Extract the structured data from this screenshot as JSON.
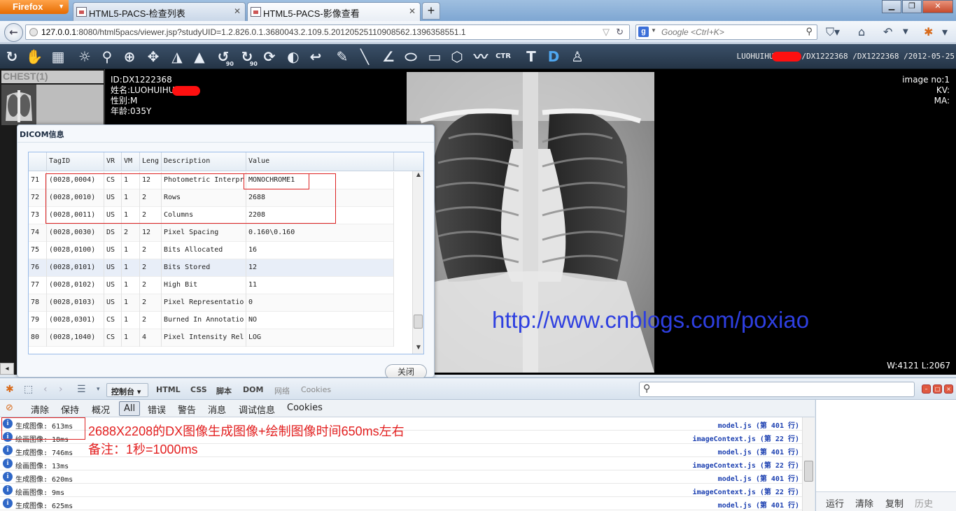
{
  "browser": {
    "app_button": "Firefox",
    "tabs": [
      {
        "label": "HTML5-PACS-检查列表"
      },
      {
        "label": "HTML5-PACS-影像查看"
      }
    ],
    "url_host": "127.0.0.1",
    "url_rest": ":8080/html5pacs/viewer.jsp?studyUID=1.2.826.0.1.3680043.2.109.5.20120525110908562.1396358551.1",
    "search_placeholder": "Google <Ctrl+K>"
  },
  "viewer": {
    "study_info_prefix": "LUOHUIHU",
    "study_info_suffix": "/DX1222368 /DX1222368 /2012-05-25",
    "series_title": "CHEST(1)",
    "patient": {
      "id_line": "ID:DX1222368",
      "name_line": "姓名:LUOHUIHU",
      "sex_line": "性别:M",
      "age_line": "年龄:035Y"
    },
    "image": {
      "image_no": "image no:1",
      "kv": "KV:",
      "ma": "MA:",
      "window_level": "W:4121 L:2067"
    },
    "watermark": "http://www.cnblogs.com/poxiao"
  },
  "dicom_dialog": {
    "title": "DICOM信息",
    "columns": [
      "TagID",
      "VR",
      "VM",
      "Leng",
      "Description",
      "Value"
    ],
    "rows": [
      {
        "n": "71",
        "tag": "(0028,0004)",
        "vr": "CS",
        "vm": "1",
        "len": "12",
        "desc": "Photometric Interpr",
        "value": "MONOCHROME1"
      },
      {
        "n": "72",
        "tag": "(0028,0010)",
        "vr": "US",
        "vm": "1",
        "len": "2",
        "desc": "Rows",
        "value": "2688"
      },
      {
        "n": "73",
        "tag": "(0028,0011)",
        "vr": "US",
        "vm": "1",
        "len": "2",
        "desc": "Columns",
        "value": "2208"
      },
      {
        "n": "74",
        "tag": "(0028,0030)",
        "vr": "DS",
        "vm": "2",
        "len": "12",
        "desc": "Pixel Spacing",
        "value": "0.160\\0.160"
      },
      {
        "n": "75",
        "tag": "(0028,0100)",
        "vr": "US",
        "vm": "1",
        "len": "2",
        "desc": "Bits Allocated",
        "value": "16"
      },
      {
        "n": "76",
        "tag": "(0028,0101)",
        "vr": "US",
        "vm": "1",
        "len": "2",
        "desc": "Bits Stored",
        "value": "12"
      },
      {
        "n": "77",
        "tag": "(0028,0102)",
        "vr": "US",
        "vm": "1",
        "len": "2",
        "desc": "High Bit",
        "value": "11"
      },
      {
        "n": "78",
        "tag": "(0028,0103)",
        "vr": "US",
        "vm": "1",
        "len": "2",
        "desc": "Pixel Representatio",
        "value": "0"
      },
      {
        "n": "79",
        "tag": "(0028,0301)",
        "vr": "CS",
        "vm": "1",
        "len": "2",
        "desc": "Burned In Annotatio",
        "value": "NO"
      },
      {
        "n": "80",
        "tag": "(0028,1040)",
        "vr": "CS",
        "vm": "1",
        "len": "4",
        "desc": "Pixel Intensity Rel",
        "value": "LOG"
      }
    ],
    "close_label": "关闭"
  },
  "firebug": {
    "console_label": "控制台",
    "tabs": [
      "HTML",
      "CSS",
      "脚本",
      "DOM",
      "网络",
      "Cookies"
    ],
    "filters": [
      "清除",
      "保持",
      "概况",
      "All",
      "错误",
      "警告",
      "消息",
      "调试信息",
      "Cookies"
    ],
    "log": [
      {
        "msg": "生成图像: 613ms",
        "src": "model.js (第 401 行)"
      },
      {
        "msg": "绘画图像: 18ms",
        "src": "imageContext.js (第 22 行)"
      },
      {
        "msg": "生成图像: 746ms",
        "src": "model.js (第 401 行)"
      },
      {
        "msg": "绘画图像: 13ms",
        "src": "imageContext.js (第 22 行)"
      },
      {
        "msg": "生成图像: 620ms",
        "src": "model.js (第 401 行)"
      },
      {
        "msg": "绘画图像: 9ms",
        "src": "imageContext.js (第 22 行)"
      },
      {
        "msg": "生成图像: 625ms",
        "src": "model.js (第 401 行)"
      }
    ],
    "annotation_line1": "2688X2208的DX图像生成图像+绘制图像时间650ms左右",
    "annotation_line2": "备注：1秒=1000ms",
    "side_buttons": [
      "运行",
      "清除",
      "复制",
      "历史"
    ]
  }
}
